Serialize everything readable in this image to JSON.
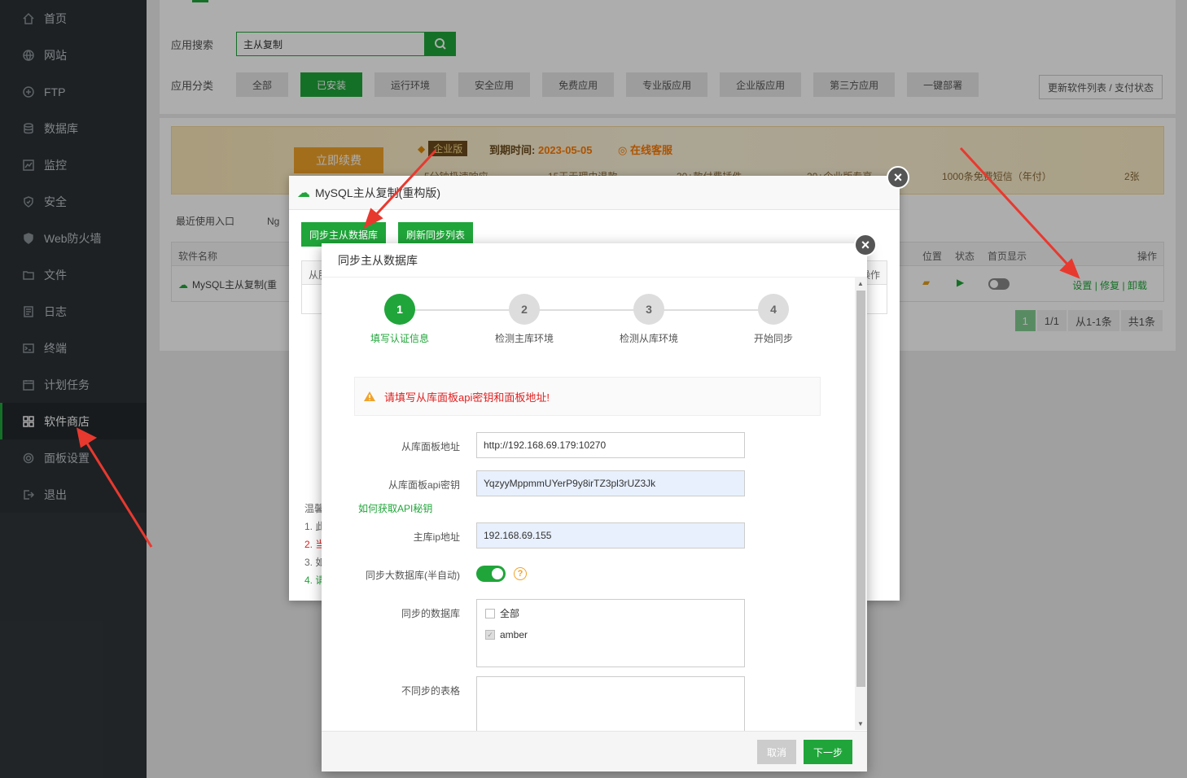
{
  "sidebar": {
    "items": [
      {
        "label": "首页",
        "icon": "home-icon"
      },
      {
        "label": "网站",
        "icon": "globe-icon"
      },
      {
        "label": "FTP",
        "icon": "ftp-icon"
      },
      {
        "label": "数据库",
        "icon": "database-icon"
      },
      {
        "label": "监控",
        "icon": "monitor-icon"
      },
      {
        "label": "安全",
        "icon": "shield-icon"
      },
      {
        "label": "Web防火墙",
        "icon": "firewall-icon"
      },
      {
        "label": "文件",
        "icon": "folder-icon"
      },
      {
        "label": "日志",
        "icon": "log-icon"
      },
      {
        "label": "终端",
        "icon": "terminal-icon"
      },
      {
        "label": "计划任务",
        "icon": "calendar-icon"
      },
      {
        "label": "软件商店",
        "icon": "grid-icon"
      },
      {
        "label": "面板设置",
        "icon": "gear-icon"
      },
      {
        "label": "退出",
        "icon": "logout-icon"
      }
    ],
    "active_index": 11
  },
  "store": {
    "search_label": "应用搜索",
    "search_value": "主从复制",
    "category_label": "应用分类",
    "categories": [
      "全部",
      "已安装",
      "运行环境",
      "安全应用",
      "免费应用",
      "专业版应用",
      "企业版应用",
      "第三方应用",
      "一键部署"
    ],
    "active_category": 1,
    "update_button": "更新软件列表 / 支付状态"
  },
  "banner": {
    "renew_button": "立即续费",
    "edition": "企业版",
    "expire_label": "到期时间:",
    "expire_date": "2023-05-05",
    "online_service": "在线客服",
    "features": [
      "5分钟极速响应",
      "15天无理由退款",
      "30+款付费插件",
      "20+企业版专享",
      "1000条免费短信（年付）",
      "2张"
    ]
  },
  "recent": {
    "label": "最近使用入口",
    "item": "Ng"
  },
  "table": {
    "headers": {
      "name": "软件名称",
      "location": "位置",
      "status": "状态",
      "home": "首页显示",
      "ops": "操作"
    },
    "row": {
      "name": "MySQL主从复制(重",
      "ops": [
        "设置",
        "修复",
        "卸载"
      ]
    }
  },
  "pager": {
    "current": "1",
    "pages": "1/1",
    "range": "从1-1条",
    "total": "共1条"
  },
  "mid_dialog": {
    "title": "MySQL主从复制(重构版)",
    "btn_sync": "同步主从数据库",
    "btn_refresh": "刷新同步列表",
    "col_from": "从服",
    "col_ops": "操作",
    "tips": [
      "温馨",
      "1. 此",
      "2. 当",
      "3. 如",
      "4. 请"
    ]
  },
  "sync_dialog": {
    "title": "同步主从数据库",
    "steps": [
      {
        "num": "1",
        "label": "填写认证信息"
      },
      {
        "num": "2",
        "label": "检测主库环境"
      },
      {
        "num": "3",
        "label": "检测从库环境"
      },
      {
        "num": "4",
        "label": "开始同步"
      }
    ],
    "warning": "请填写从库面板api密钥和面板地址!",
    "fields": {
      "slave_url_label": "从库面板地址",
      "slave_url_value": "http://192.168.69.179:10270",
      "slave_api_label": "从库面板api密钥",
      "slave_api_value": "YqzyyMppmmUYerP9y8irTZ3pl3rUZ3Jk",
      "api_help": "如何获取API秘钥",
      "master_ip_label": "主库ip地址",
      "master_ip_value": "192.168.69.155",
      "big_db_label": "同步大数据库(半自动)",
      "big_db_on": true,
      "dbs_label": "同步的数据库",
      "db_options": [
        {
          "name": "全部",
          "checked": false
        },
        {
          "name": "amber",
          "checked": true
        }
      ],
      "exclude_label": "不同步的表格"
    },
    "cancel": "取消",
    "next": "下一步"
  },
  "colors": {
    "accent": "#20a53a",
    "sidebar": "#30363a",
    "warn": "#e02020",
    "arrow": "#e8392f"
  }
}
